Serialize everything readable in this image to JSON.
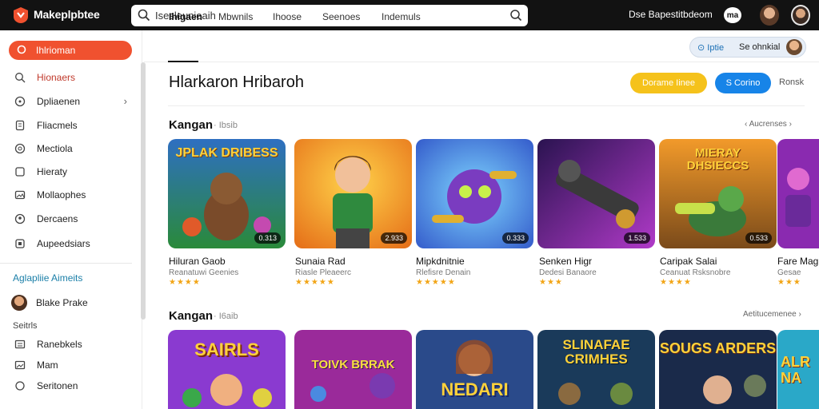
{
  "app": {
    "brand": "Makeplpbtee"
  },
  "search": {
    "value": "Isesleunieaih"
  },
  "topbar": {
    "user_label": "Dse Bapestitbdeom",
    "badge": "ma"
  },
  "sidebar": {
    "active": "Ihlrioman",
    "items": [
      "Hionaers",
      "Dpliaenen",
      "Fliacmels",
      "Mectiola",
      "Hieraty",
      "Mollaophes",
      "Dercaens",
      "Aupeedsiars"
    ],
    "section_header": "Aglapliie Aimeits",
    "person": "Blake Prake",
    "small_label": "Seitrls",
    "lower_items": [
      "Ranebkels",
      "Mam",
      "Seritonen"
    ]
  },
  "tabs": [
    "Ihigaen",
    "Mbwnils",
    "Ihoose",
    "Seenoes",
    "Indemuls"
  ],
  "pill": {
    "left": "Iptie",
    "right": "Se ohnkial"
  },
  "page": {
    "title": "Hlarkaron Hribaroh",
    "btn_primary": "Dorame Iinee",
    "btn_secondary": "S Corino",
    "link": "Ronsk"
  },
  "sections": [
    {
      "title": "Kangan",
      "subtitle": "· Ibsib",
      "link": "Aucrenses",
      "cards": [
        {
          "art_text": "JPLAK DRIBESS",
          "badge": "0.313",
          "title": "Hiluran Gaob",
          "sub": "Reanatuwi Geenies",
          "stars": "★★★★"
        },
        {
          "art_text": "",
          "badge": "2.933",
          "title": "Sunaia Rad",
          "sub": "Riasle Pleaeerc",
          "stars": "★★★★★"
        },
        {
          "art_text": "",
          "badge": "0.333",
          "title": "Mipkdnitnie",
          "sub": "Rlefisre Denain",
          "stars": "★★★★★"
        },
        {
          "art_text": "",
          "badge": "1.533",
          "title": "Senken Higr",
          "sub": "Dedesi Banaore",
          "stars": "★★★"
        },
        {
          "art_text": "MIERAY DHSIECCS",
          "badge": "0.533",
          "title": "Caripak Salai",
          "sub": "Ceanuat Rsksnobre",
          "stars": "★★★★"
        },
        {
          "art_text": "",
          "badge": "",
          "title": "Fare Mag",
          "sub": "Gesae",
          "stars": "★★★"
        }
      ]
    },
    {
      "title": "Kangan",
      "subtitle": "· I6aib",
      "link": "Aetitucemenee",
      "cards": [
        {
          "art_text": "SAIRLS",
          "badge": "",
          "title": "",
          "sub": "",
          "stars": ""
        },
        {
          "art_text": "TOIVK BRRAK",
          "badge": "",
          "title": "",
          "sub": "",
          "stars": ""
        },
        {
          "art_text": "NEDARI",
          "badge": "",
          "title": "",
          "sub": "",
          "stars": ""
        },
        {
          "art_text": "SLINAFAE CRIMHES",
          "badge": "",
          "title": "",
          "sub": "",
          "stars": ""
        },
        {
          "art_text": "SOUGS ARDERS",
          "badge": "",
          "title": "",
          "sub": "",
          "stars": ""
        },
        {
          "art_text": "ALR NA",
          "badge": "",
          "title": "",
          "sub": "",
          "stars": ""
        }
      ]
    }
  ],
  "colors": {
    "accent": "#f0512f",
    "topbar": "#121212",
    "yellow": "#f5c21b",
    "blue": "#1784e8",
    "star": "#f2a516"
  },
  "icons": [
    "logo-icon",
    "search-icon",
    "mic-icon",
    "chevron-right-icon",
    "info-icon"
  ]
}
